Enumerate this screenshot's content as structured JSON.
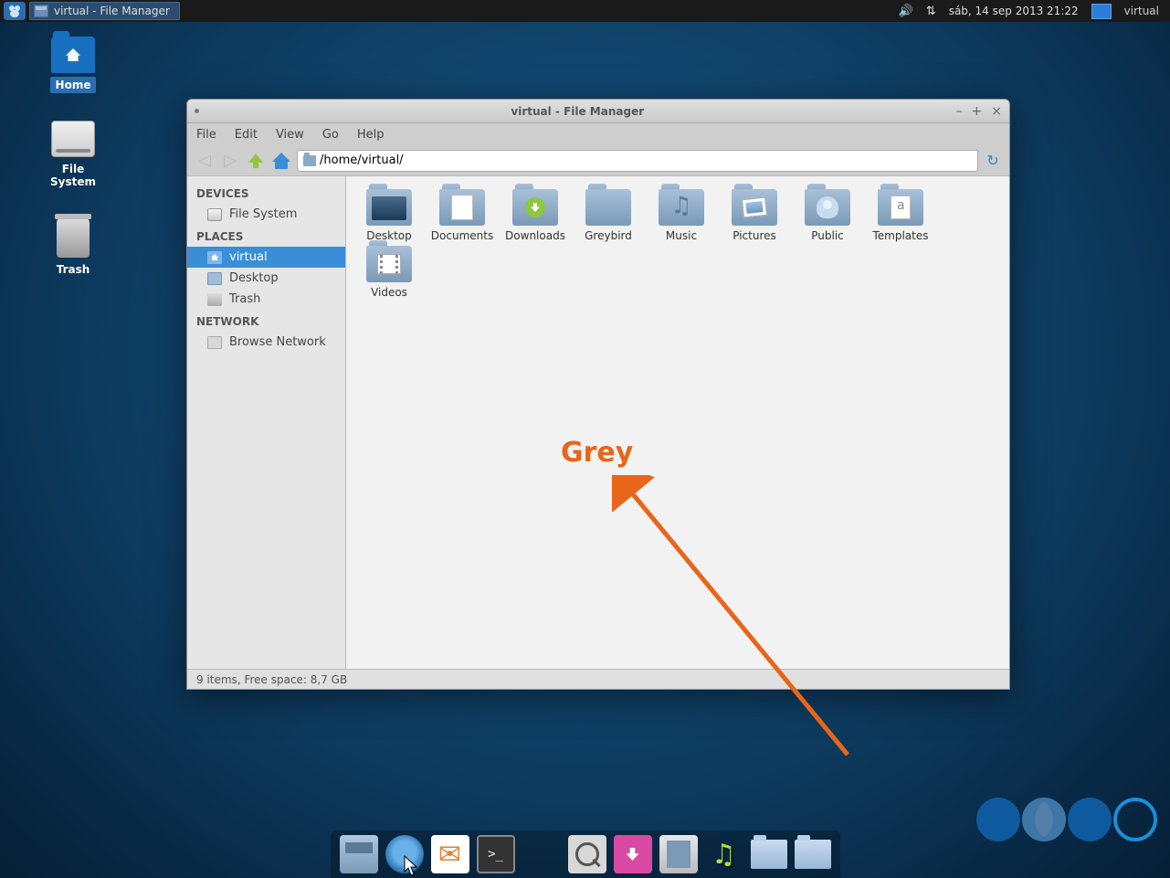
{
  "panel": {
    "taskbar_item": "virtual - File Manager",
    "datetime": "sáb, 14 sep 2013 21:22",
    "user": "virtual"
  },
  "desktop_icons": {
    "home": "Home",
    "fs": "File System",
    "trash": "Trash"
  },
  "window": {
    "title": "virtual - File Manager",
    "menus": {
      "file": "File",
      "edit": "Edit",
      "view": "View",
      "go": "Go",
      "help": "Help"
    },
    "path": "/home/virtual/",
    "sidebar": {
      "devices_label": "DEVICES",
      "devices": {
        "fs": "File System"
      },
      "places_label": "PLACES",
      "places": {
        "virtual": "virtual",
        "desktop": "Desktop",
        "trash": "Trash"
      },
      "network_label": "NETWORK",
      "network": {
        "browse": "Browse Network"
      }
    },
    "folders": {
      "desktop": "Desktop",
      "documents": "Documents",
      "downloads": "Downloads",
      "greybird": "Greybird",
      "music": "Music",
      "pictures": "Pictures",
      "public": "Public",
      "templates": "Templates",
      "videos": "Videos"
    },
    "statusbar": "9 items, Free space: 8,7 GB"
  },
  "annotation": {
    "text": "Grey"
  }
}
